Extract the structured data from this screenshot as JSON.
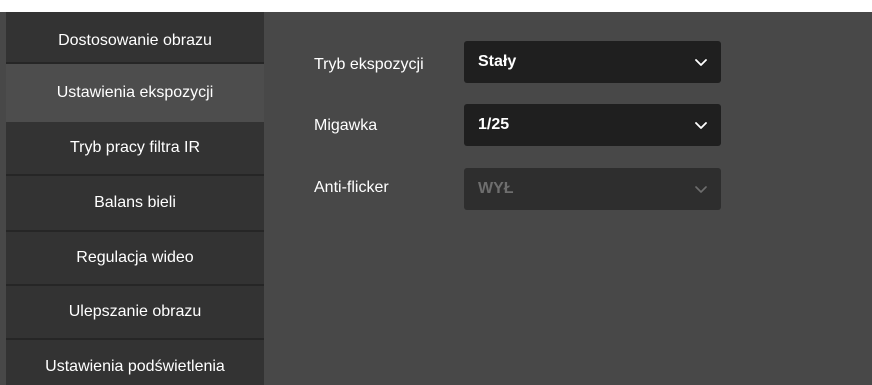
{
  "sidebar": {
    "items": [
      {
        "label": "Dostosowanie obrazu"
      },
      {
        "label": "Ustawienia ekspozycji"
      },
      {
        "label": "Tryb pracy filtra IR"
      },
      {
        "label": "Balans bieli"
      },
      {
        "label": "Regulacja wideo"
      },
      {
        "label": "Ulepszanie obrazu"
      },
      {
        "label": "Ustawienia podświetlenia"
      }
    ],
    "active_index": 1
  },
  "form": {
    "exposure_mode": {
      "label": "Tryb ekspozycji",
      "value": "Stały",
      "disabled": false
    },
    "shutter": {
      "label": "Migawka",
      "value": "1/25",
      "disabled": false
    },
    "anti_flicker": {
      "label": "Anti-flicker",
      "value": "WYŁ",
      "disabled": true
    }
  },
  "icons": {
    "dropdown": "chevron-down-icon"
  },
  "colors": {
    "page_bg": "#484848",
    "sidebar_bg": "#333333",
    "sidebar_active_bg": "#4d4d4d",
    "select_bg": "#1f1f1f",
    "select_disabled_bg": "#2e2e2e",
    "text": "#ffffff",
    "text_disabled": "#6e6e6e"
  }
}
